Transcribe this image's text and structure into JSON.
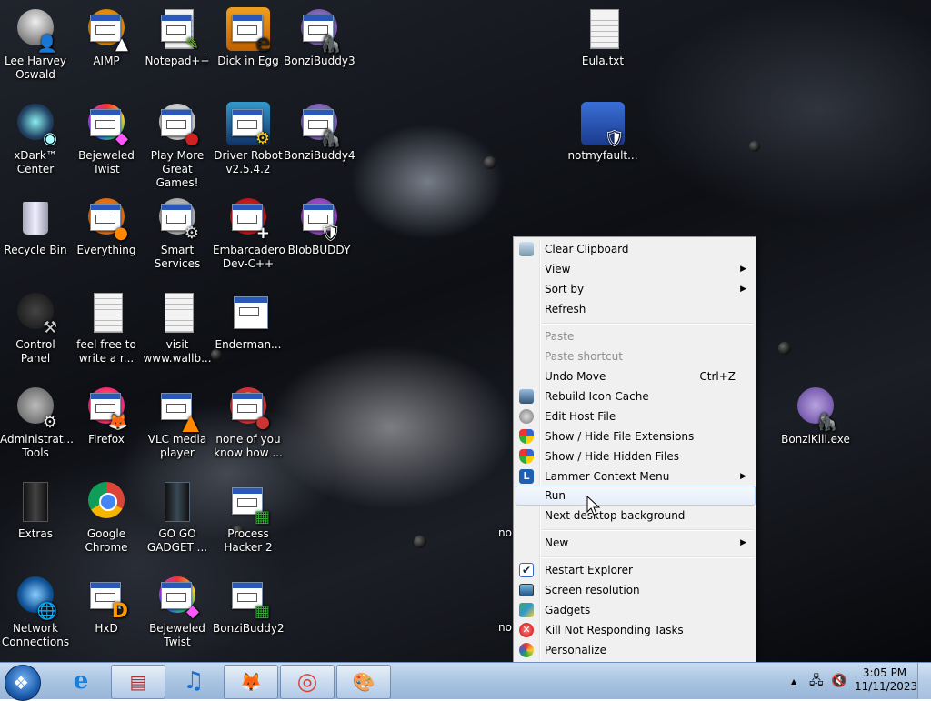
{
  "desktop_icons": [
    {
      "label": "Lee Harvey Oswald",
      "glyph": "👤"
    },
    {
      "label": "AIMP",
      "glyph": "▲"
    },
    {
      "label": "Notepad++",
      "glyph": "✎"
    },
    {
      "label": "Dick in Egg",
      "glyph": "e"
    },
    {
      "label": "BonziBuddy3",
      "glyph": "🦍"
    },
    {
      "label": "Eula.txt",
      "glyph": ""
    },
    {
      "label": "xDark™ Center",
      "glyph": "◉"
    },
    {
      "label": "Bejeweled Twist",
      "glyph": "◆"
    },
    {
      "label": "Play More Great Games!",
      "glyph": "●"
    },
    {
      "label": "Driver Robot v2.5.4.2",
      "glyph": "⚙"
    },
    {
      "label": "BonziBuddy4",
      "glyph": "🦍"
    },
    {
      "label": "notmyfault...",
      "glyph": "🛡"
    },
    {
      "label": "Recycle Bin",
      "glyph": "🗑"
    },
    {
      "label": "Everything",
      "glyph": "●"
    },
    {
      "label": "Smart Services",
      "glyph": "⚙"
    },
    {
      "label": "Embarcadero Dev-C++",
      "glyph": "+"
    },
    {
      "label": "BlobBUDDY",
      "glyph": "🛡"
    },
    {
      "label": "Control Panel",
      "glyph": "⚒"
    },
    {
      "label": "feel free to write a r...",
      "glyph": ""
    },
    {
      "label": "visit www.wallb...",
      "glyph": ""
    },
    {
      "label": "Enderman...",
      "glyph": ""
    },
    {
      "label": "Administrat... Tools",
      "glyph": "⚙"
    },
    {
      "label": "Firefox",
      "glyph": "🦊"
    },
    {
      "label": "VLC media player",
      "glyph": "▲"
    },
    {
      "label": "none of you know how ...",
      "glyph": "●"
    },
    {
      "label": "BonziKill.exe",
      "glyph": "🦍"
    },
    {
      "label": "Extras",
      "glyph": "▮"
    },
    {
      "label": "Google Chrome",
      "glyph": "◎"
    },
    {
      "label": "GO GO GADGET ...",
      "glyph": "▮"
    },
    {
      "label": "Process Hacker 2",
      "glyph": "▦"
    },
    {
      "label": "Network Connections",
      "glyph": "🌐"
    },
    {
      "label": "HxD",
      "glyph": "D"
    },
    {
      "label": "Bejeweled Twist",
      "glyph": "◆"
    },
    {
      "label": "BonziBuddy2",
      "glyph": "▦"
    }
  ],
  "hidden_partial_labels": [
    "no",
    "no"
  ],
  "context_menu": {
    "items": [
      {
        "label": "Clear Clipboard",
        "icon": "clipboard-icon"
      },
      {
        "label": "View",
        "submenu": true
      },
      {
        "label": "Sort by",
        "submenu": true
      },
      {
        "label": "Refresh"
      },
      {
        "label": "Paste",
        "disabled": true
      },
      {
        "label": "Paste shortcut",
        "disabled": true
      },
      {
        "label": "Undo Move",
        "shortcut": "Ctrl+Z"
      },
      {
        "label": "Rebuild Icon Cache",
        "icon": "rebuild-icon"
      },
      {
        "label": "Edit Host File",
        "icon": "gear-icon"
      },
      {
        "label": "Show / Hide File Extensions",
        "icon": "shield-icon"
      },
      {
        "label": "Show / Hide Hidden Files",
        "icon": "shield-icon"
      },
      {
        "label": "Lammer Context Menu",
        "icon": "l-icon",
        "submenu": true
      },
      {
        "label": "Run",
        "highlighted": true
      },
      {
        "label": "Next desktop background"
      },
      {
        "label": "New",
        "submenu": true
      },
      {
        "label": "Restart Explorer",
        "icon": "check-icon"
      },
      {
        "label": "Screen resolution",
        "icon": "monitor-icon"
      },
      {
        "label": "Gadgets",
        "icon": "gadgets-icon"
      },
      {
        "label": "Kill Not Responding Tasks",
        "icon": "kill-icon"
      },
      {
        "label": "Personalize",
        "icon": "personalize-icon"
      }
    ]
  },
  "taskbar": {
    "start_glyph": "❖",
    "apps": [
      {
        "name": "internet-explorer",
        "glyph": "e"
      },
      {
        "name": "winrar",
        "glyph": "▤"
      },
      {
        "name": "music",
        "glyph": "♫"
      },
      {
        "name": "firefox",
        "glyph": "🦊"
      },
      {
        "name": "chrome",
        "glyph": "◎"
      },
      {
        "name": "paint",
        "glyph": "🎨"
      }
    ],
    "tray": {
      "arrow": "▲",
      "network": "🖧",
      "volume": "🔇"
    },
    "time": "3:05 PM",
    "date": "11/11/2023"
  },
  "colors": {
    "menu_bg": "#f0f0f0",
    "menu_highlight": "#e6eef9",
    "taskbar": "#a9c4e2"
  }
}
